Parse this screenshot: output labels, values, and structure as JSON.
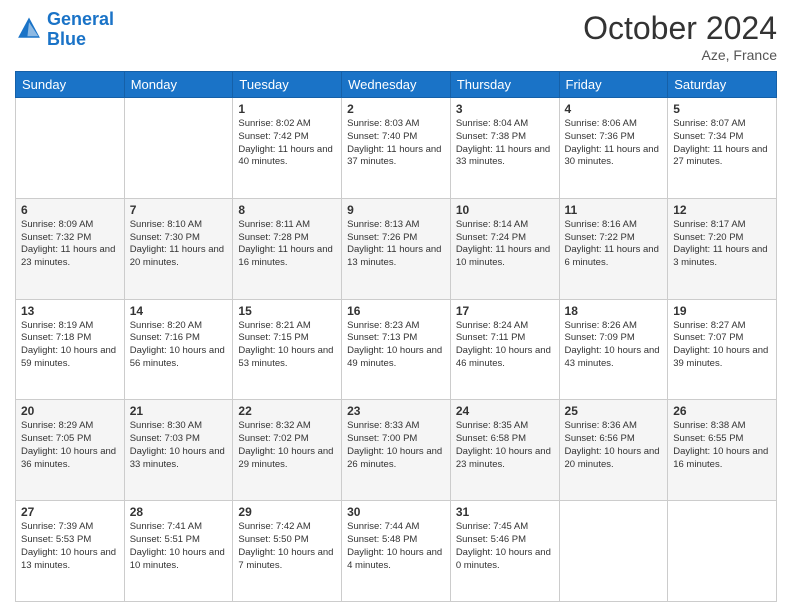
{
  "header": {
    "logo_line1": "General",
    "logo_line2": "Blue",
    "month": "October 2024",
    "location": "Aze, France"
  },
  "days_of_week": [
    "Sunday",
    "Monday",
    "Tuesday",
    "Wednesday",
    "Thursday",
    "Friday",
    "Saturday"
  ],
  "weeks": [
    [
      {
        "day": "",
        "sunrise": "",
        "sunset": "",
        "daylight": ""
      },
      {
        "day": "",
        "sunrise": "",
        "sunset": "",
        "daylight": ""
      },
      {
        "day": "1",
        "sunrise": "Sunrise: 8:02 AM",
        "sunset": "Sunset: 7:42 PM",
        "daylight": "Daylight: 11 hours and 40 minutes."
      },
      {
        "day": "2",
        "sunrise": "Sunrise: 8:03 AM",
        "sunset": "Sunset: 7:40 PM",
        "daylight": "Daylight: 11 hours and 37 minutes."
      },
      {
        "day": "3",
        "sunrise": "Sunrise: 8:04 AM",
        "sunset": "Sunset: 7:38 PM",
        "daylight": "Daylight: 11 hours and 33 minutes."
      },
      {
        "day": "4",
        "sunrise": "Sunrise: 8:06 AM",
        "sunset": "Sunset: 7:36 PM",
        "daylight": "Daylight: 11 hours and 30 minutes."
      },
      {
        "day": "5",
        "sunrise": "Sunrise: 8:07 AM",
        "sunset": "Sunset: 7:34 PM",
        "daylight": "Daylight: 11 hours and 27 minutes."
      }
    ],
    [
      {
        "day": "6",
        "sunrise": "Sunrise: 8:09 AM",
        "sunset": "Sunset: 7:32 PM",
        "daylight": "Daylight: 11 hours and 23 minutes."
      },
      {
        "day": "7",
        "sunrise": "Sunrise: 8:10 AM",
        "sunset": "Sunset: 7:30 PM",
        "daylight": "Daylight: 11 hours and 20 minutes."
      },
      {
        "day": "8",
        "sunrise": "Sunrise: 8:11 AM",
        "sunset": "Sunset: 7:28 PM",
        "daylight": "Daylight: 11 hours and 16 minutes."
      },
      {
        "day": "9",
        "sunrise": "Sunrise: 8:13 AM",
        "sunset": "Sunset: 7:26 PM",
        "daylight": "Daylight: 11 hours and 13 minutes."
      },
      {
        "day": "10",
        "sunrise": "Sunrise: 8:14 AM",
        "sunset": "Sunset: 7:24 PM",
        "daylight": "Daylight: 11 hours and 10 minutes."
      },
      {
        "day": "11",
        "sunrise": "Sunrise: 8:16 AM",
        "sunset": "Sunset: 7:22 PM",
        "daylight": "Daylight: 11 hours and 6 minutes."
      },
      {
        "day": "12",
        "sunrise": "Sunrise: 8:17 AM",
        "sunset": "Sunset: 7:20 PM",
        "daylight": "Daylight: 11 hours and 3 minutes."
      }
    ],
    [
      {
        "day": "13",
        "sunrise": "Sunrise: 8:19 AM",
        "sunset": "Sunset: 7:18 PM",
        "daylight": "Daylight: 10 hours and 59 minutes."
      },
      {
        "day": "14",
        "sunrise": "Sunrise: 8:20 AM",
        "sunset": "Sunset: 7:16 PM",
        "daylight": "Daylight: 10 hours and 56 minutes."
      },
      {
        "day": "15",
        "sunrise": "Sunrise: 8:21 AM",
        "sunset": "Sunset: 7:15 PM",
        "daylight": "Daylight: 10 hours and 53 minutes."
      },
      {
        "day": "16",
        "sunrise": "Sunrise: 8:23 AM",
        "sunset": "Sunset: 7:13 PM",
        "daylight": "Daylight: 10 hours and 49 minutes."
      },
      {
        "day": "17",
        "sunrise": "Sunrise: 8:24 AM",
        "sunset": "Sunset: 7:11 PM",
        "daylight": "Daylight: 10 hours and 46 minutes."
      },
      {
        "day": "18",
        "sunrise": "Sunrise: 8:26 AM",
        "sunset": "Sunset: 7:09 PM",
        "daylight": "Daylight: 10 hours and 43 minutes."
      },
      {
        "day": "19",
        "sunrise": "Sunrise: 8:27 AM",
        "sunset": "Sunset: 7:07 PM",
        "daylight": "Daylight: 10 hours and 39 minutes."
      }
    ],
    [
      {
        "day": "20",
        "sunrise": "Sunrise: 8:29 AM",
        "sunset": "Sunset: 7:05 PM",
        "daylight": "Daylight: 10 hours and 36 minutes."
      },
      {
        "day": "21",
        "sunrise": "Sunrise: 8:30 AM",
        "sunset": "Sunset: 7:03 PM",
        "daylight": "Daylight: 10 hours and 33 minutes."
      },
      {
        "day": "22",
        "sunrise": "Sunrise: 8:32 AM",
        "sunset": "Sunset: 7:02 PM",
        "daylight": "Daylight: 10 hours and 29 minutes."
      },
      {
        "day": "23",
        "sunrise": "Sunrise: 8:33 AM",
        "sunset": "Sunset: 7:00 PM",
        "daylight": "Daylight: 10 hours and 26 minutes."
      },
      {
        "day": "24",
        "sunrise": "Sunrise: 8:35 AM",
        "sunset": "Sunset: 6:58 PM",
        "daylight": "Daylight: 10 hours and 23 minutes."
      },
      {
        "day": "25",
        "sunrise": "Sunrise: 8:36 AM",
        "sunset": "Sunset: 6:56 PM",
        "daylight": "Daylight: 10 hours and 20 minutes."
      },
      {
        "day": "26",
        "sunrise": "Sunrise: 8:38 AM",
        "sunset": "Sunset: 6:55 PM",
        "daylight": "Daylight: 10 hours and 16 minutes."
      }
    ],
    [
      {
        "day": "27",
        "sunrise": "Sunrise: 7:39 AM",
        "sunset": "Sunset: 5:53 PM",
        "daylight": "Daylight: 10 hours and 13 minutes."
      },
      {
        "day": "28",
        "sunrise": "Sunrise: 7:41 AM",
        "sunset": "Sunset: 5:51 PM",
        "daylight": "Daylight: 10 hours and 10 minutes."
      },
      {
        "day": "29",
        "sunrise": "Sunrise: 7:42 AM",
        "sunset": "Sunset: 5:50 PM",
        "daylight": "Daylight: 10 hours and 7 minutes."
      },
      {
        "day": "30",
        "sunrise": "Sunrise: 7:44 AM",
        "sunset": "Sunset: 5:48 PM",
        "daylight": "Daylight: 10 hours and 4 minutes."
      },
      {
        "day": "31",
        "sunrise": "Sunrise: 7:45 AM",
        "sunset": "Sunset: 5:46 PM",
        "daylight": "Daylight: 10 hours and 0 minutes."
      },
      {
        "day": "",
        "sunrise": "",
        "sunset": "",
        "daylight": ""
      },
      {
        "day": "",
        "sunrise": "",
        "sunset": "",
        "daylight": ""
      }
    ]
  ]
}
